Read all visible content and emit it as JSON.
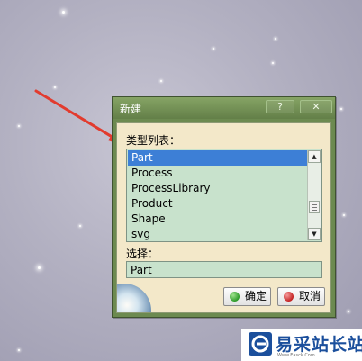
{
  "dialog": {
    "title": "新建",
    "help_icon": "question-mark-icon",
    "close_icon": "close-icon",
    "type_list_label": "类型列表：",
    "type_list": {
      "items": [
        "Part",
        "Process",
        "ProcessLibrary",
        "Product",
        "Shape",
        "svg"
      ],
      "selected": "Part"
    },
    "selection_label": "选择：",
    "selection_value": "Part",
    "ok_label": "确定",
    "cancel_label": "取消"
  },
  "watermark": {
    "name": "易采站长站",
    "url": "Www.Easck.Com"
  },
  "colors": {
    "dialog_frame": "#6c8a50",
    "dialog_body": "#f3e8c9",
    "list_background": "#c8e2cc",
    "selection_highlight": "#3d7fd6",
    "arrow": "#e23b2e",
    "watermark_text": "#1b4f9c"
  }
}
